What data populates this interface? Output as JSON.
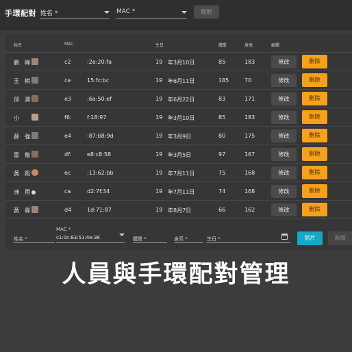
{
  "header": {
    "title": "手環配對",
    "name_select_label": "姓名 *",
    "mac_select_label": "MAC *",
    "pair_button": "配對"
  },
  "table": {
    "columns": [
      "姓名",
      "MAC",
      "生日",
      "體重",
      "身高",
      "編輯"
    ],
    "edit_label": "修改",
    "delete_label": "刪除",
    "rows": [
      {
        "name": "劉　峰",
        "mac_a": "c2",
        "mac_b": ":2e:20:fa",
        "birth_a": "19",
        "birth_b": "年3月10日",
        "weight": "85",
        "height": "183"
      },
      {
        "name": "王　棋",
        "mac_a": "ce",
        "mac_b": "15:fc:bc",
        "birth_a": "19",
        "birth_b": "年6月11日",
        "weight": "185",
        "height": "70"
      },
      {
        "name": "邱　潤",
        "mac_a": "e3",
        "mac_b": ":6a:50:ef",
        "birth_a": "19",
        "birth_b": "年6月22日",
        "weight": "83",
        "height": "171"
      },
      {
        "name": "小",
        "mac_a": "f6:",
        "mac_b": "f:18:97",
        "birth_a": "19",
        "birth_b": "年3月10日",
        "weight": "85",
        "height": "183"
      },
      {
        "name": "薛　強",
        "mac_a": "e4",
        "mac_b": ":87:b8:9d",
        "birth_a": "19",
        "birth_b": "年3月9日",
        "weight": "80",
        "height": "175"
      },
      {
        "name": "雷　龍",
        "mac_a": "df:",
        "mac_b": "e8:c8:58",
        "birth_a": "19",
        "birth_b": "年3月5日",
        "weight": "97",
        "height": "167"
      },
      {
        "name": "黃　熙",
        "mac_a": "ec",
        "mac_b": ":13:62:bb",
        "birth_a": "19",
        "birth_b": "年7月11日",
        "weight": "75",
        "height": "168"
      },
      {
        "name": "洲　用",
        "mac_a": "ca",
        "mac_b": "d2:7f:34",
        "birth_a": "19",
        "birth_b": "年7月11日",
        "weight": "74",
        "height": "168"
      },
      {
        "name": "黃　霖",
        "mac_a": "d4",
        "mac_b": "1d:71:87",
        "birth_a": "19",
        "birth_b": "年8月7日",
        "weight": "66",
        "height": "162"
      }
    ]
  },
  "form": {
    "name_label": "姓名 *",
    "mac_label": "MAC *",
    "mac_value": "c1:0c:83:51:4e:38",
    "weight_label": "體重 *",
    "height_label": "身高 *",
    "birth_label": "生日 *",
    "photo_button": "照片",
    "add_button": "新增"
  },
  "caption": "人員與手環配對管理",
  "colors": {
    "delete": "#f7a11a",
    "photo": "#16a7c9",
    "background": "#3c3c3c"
  }
}
